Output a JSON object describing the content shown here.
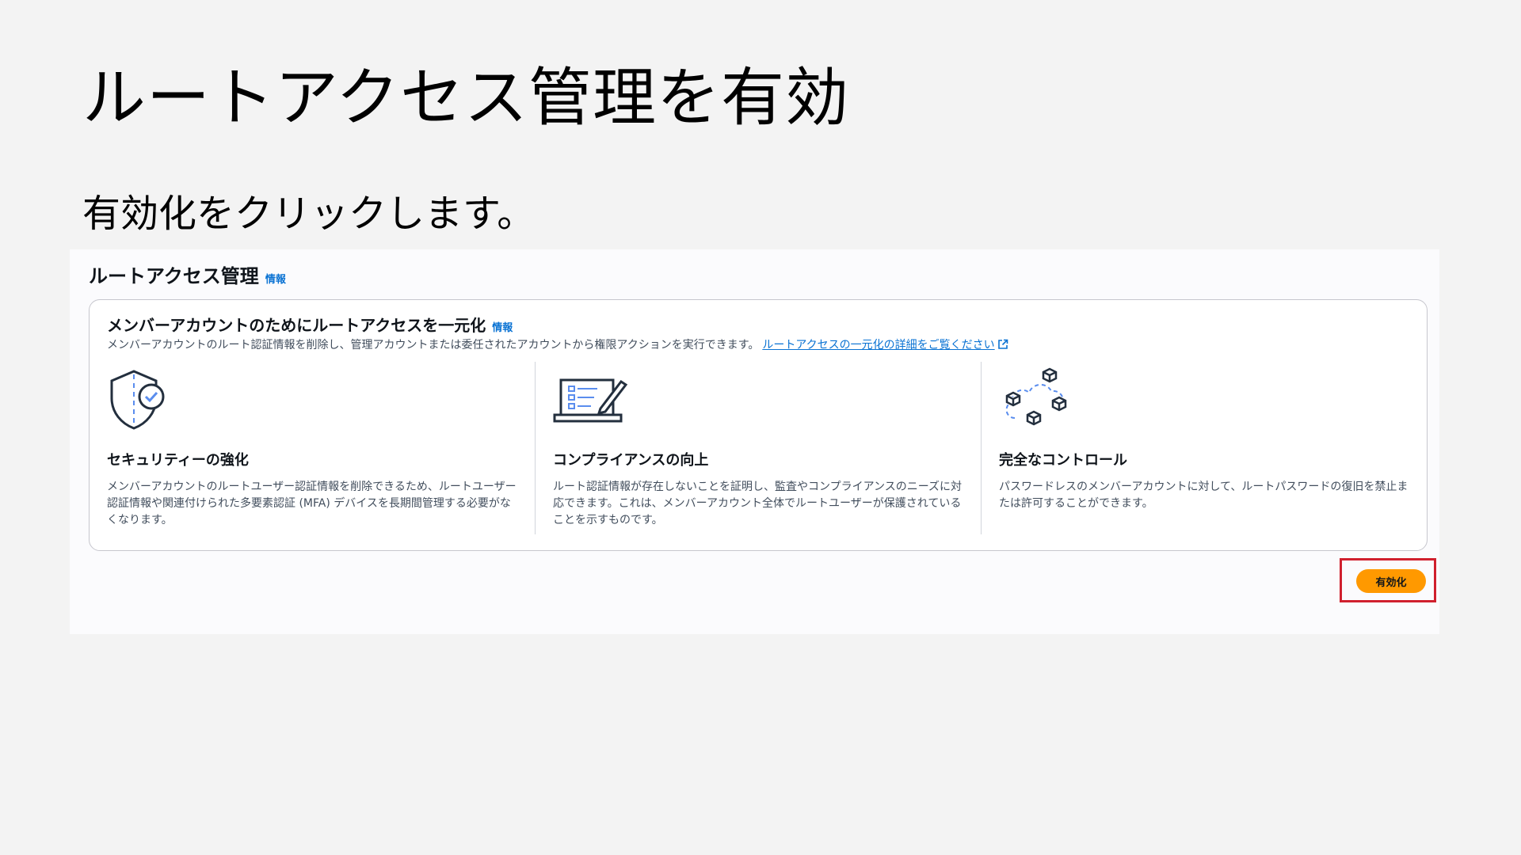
{
  "slide": {
    "title": "ルートアクセス管理を有効",
    "subtitle": "有効化をクリックします。"
  },
  "screenshot": {
    "header": {
      "title": "ルートアクセス管理",
      "info": "情報"
    },
    "panel": {
      "title": "メンバーアカウントのためにルートアクセスを一元化",
      "info": "情報",
      "description": "メンバーアカウントのルート認証情報を削除し、管理アカウントまたは委任されたアカウントから権限アクションを実行できます。",
      "learn_more_link": "ルートアクセスの一元化の詳細をご覧ください",
      "features": [
        {
          "icon": "shield-check-icon",
          "title": "セキュリティーの強化",
          "text": "メンバーアカウントのルートユーザー認証情報を削除できるため、ルートユーザー認証情報や関連付けられた多要素認証 (MFA) デバイスを長期間管理する必要がなくなります。"
        },
        {
          "icon": "laptop-checklist-icon",
          "title": "コンプライアンスの向上",
          "text": "ルート認証情報が存在しないことを証明し、監査やコンプライアンスのニーズに対応できます。これは、メンバーアカウント全体でルートユーザーが保護されていることを示すものです。"
        },
        {
          "icon": "cloud-cubes-icon",
          "title": "完全なコントロール",
          "text": "パスワードレスのメンバーアカウントに対して、ルートパスワードの復旧を禁止または許可することができます。"
        }
      ]
    },
    "enable_button": "有効化"
  },
  "colors": {
    "accent": "#ff9900",
    "link": "#0972d3",
    "highlight": "#d0202e"
  }
}
